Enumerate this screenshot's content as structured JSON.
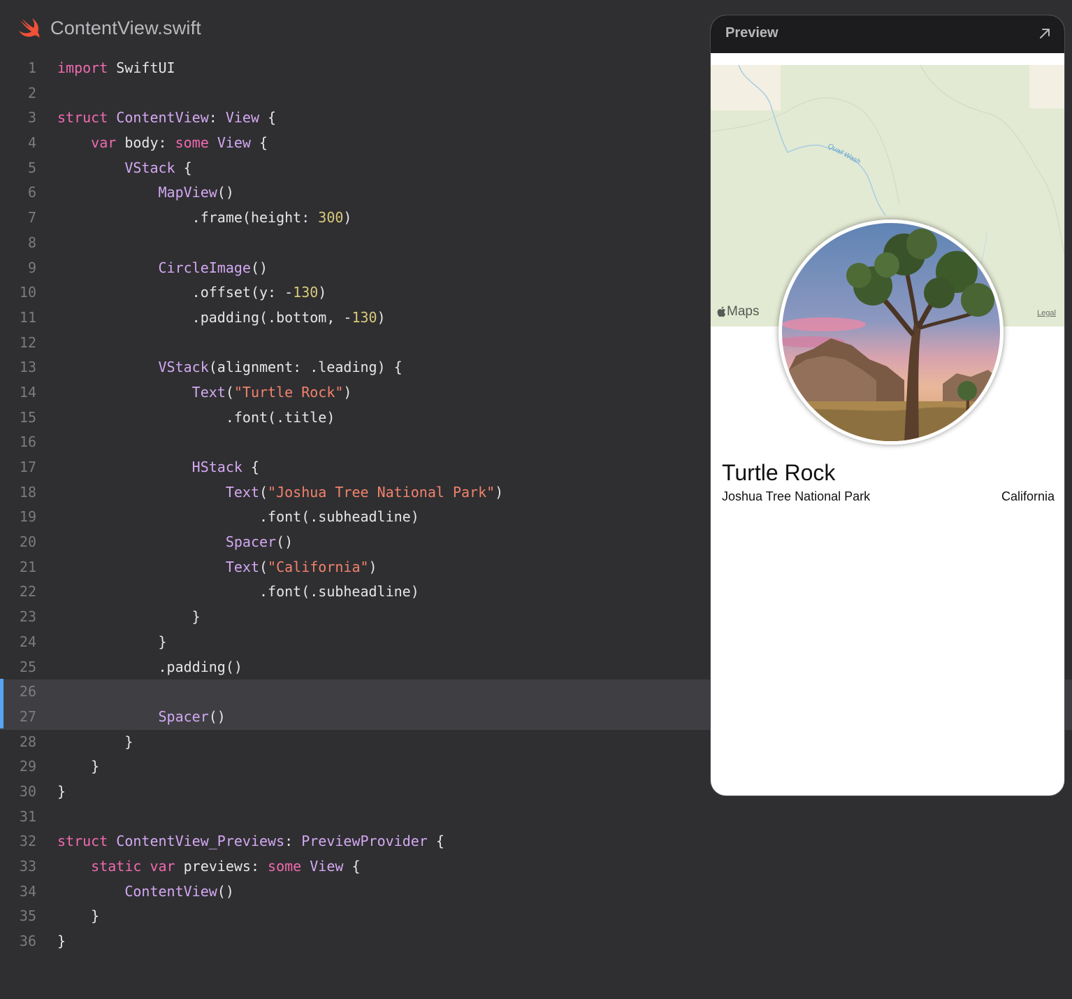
{
  "file": {
    "name": "ContentView.swift",
    "icon": "swift-icon",
    "icon_color": "#f05138"
  },
  "editor": {
    "active_lines": [
      26,
      27
    ],
    "lines": [
      {
        "n": "1",
        "tokens": [
          {
            "t": "import",
            "c": "kw"
          },
          {
            "t": " SwiftUI",
            "c": ""
          }
        ]
      },
      {
        "n": "2",
        "tokens": []
      },
      {
        "n": "3",
        "tokens": [
          {
            "t": "struct",
            "c": "kw"
          },
          {
            "t": " ",
            "c": ""
          },
          {
            "t": "ContentView",
            "c": "ty"
          },
          {
            "t": ": ",
            "c": ""
          },
          {
            "t": "View",
            "c": "ty"
          },
          {
            "t": " {",
            "c": ""
          }
        ]
      },
      {
        "n": "4",
        "tokens": [
          {
            "t": "    ",
            "c": ""
          },
          {
            "t": "var",
            "c": "kw"
          },
          {
            "t": " body: ",
            "c": ""
          },
          {
            "t": "some",
            "c": "kw"
          },
          {
            "t": " ",
            "c": ""
          },
          {
            "t": "View",
            "c": "ty"
          },
          {
            "t": " {",
            "c": ""
          }
        ]
      },
      {
        "n": "5",
        "tokens": [
          {
            "t": "        ",
            "c": ""
          },
          {
            "t": "VStack",
            "c": "ty"
          },
          {
            "t": " {",
            "c": ""
          }
        ]
      },
      {
        "n": "6",
        "tokens": [
          {
            "t": "            ",
            "c": ""
          },
          {
            "t": "MapView",
            "c": "ty"
          },
          {
            "t": "()",
            "c": ""
          }
        ]
      },
      {
        "n": "7",
        "tokens": [
          {
            "t": "                .frame(height: ",
            "c": ""
          },
          {
            "t": "300",
            "c": "nm"
          },
          {
            "t": ")",
            "c": ""
          }
        ]
      },
      {
        "n": "8",
        "tokens": []
      },
      {
        "n": "9",
        "tokens": [
          {
            "t": "            ",
            "c": ""
          },
          {
            "t": "CircleImage",
            "c": "ty"
          },
          {
            "t": "()",
            "c": ""
          }
        ]
      },
      {
        "n": "10",
        "tokens": [
          {
            "t": "                .offset(y: -",
            "c": ""
          },
          {
            "t": "130",
            "c": "nm"
          },
          {
            "t": ")",
            "c": ""
          }
        ]
      },
      {
        "n": "11",
        "tokens": [
          {
            "t": "                .padding(.bottom, -",
            "c": ""
          },
          {
            "t": "130",
            "c": "nm"
          },
          {
            "t": ")",
            "c": ""
          }
        ]
      },
      {
        "n": "12",
        "tokens": []
      },
      {
        "n": "13",
        "tokens": [
          {
            "t": "            ",
            "c": ""
          },
          {
            "t": "VStack",
            "c": "ty"
          },
          {
            "t": "(alignment: .leading) {",
            "c": ""
          }
        ]
      },
      {
        "n": "14",
        "tokens": [
          {
            "t": "                ",
            "c": ""
          },
          {
            "t": "Text",
            "c": "ty"
          },
          {
            "t": "(",
            "c": ""
          },
          {
            "t": "\"Turtle Rock\"",
            "c": "st"
          },
          {
            "t": ")",
            "c": ""
          }
        ]
      },
      {
        "n": "15",
        "tokens": [
          {
            "t": "                    .font(.title)",
            "c": ""
          }
        ]
      },
      {
        "n": "16",
        "tokens": []
      },
      {
        "n": "17",
        "tokens": [
          {
            "t": "                ",
            "c": ""
          },
          {
            "t": "HStack",
            "c": "ty"
          },
          {
            "t": " {",
            "c": ""
          }
        ]
      },
      {
        "n": "18",
        "tokens": [
          {
            "t": "                    ",
            "c": ""
          },
          {
            "t": "Text",
            "c": "ty"
          },
          {
            "t": "(",
            "c": ""
          },
          {
            "t": "\"Joshua Tree National Park\"",
            "c": "st"
          },
          {
            "t": ")",
            "c": ""
          }
        ]
      },
      {
        "n": "19",
        "tokens": [
          {
            "t": "                        .font(.subheadline)",
            "c": ""
          }
        ]
      },
      {
        "n": "20",
        "tokens": [
          {
            "t": "                    ",
            "c": ""
          },
          {
            "t": "Spacer",
            "c": "ty"
          },
          {
            "t": "()",
            "c": ""
          }
        ]
      },
      {
        "n": "21",
        "tokens": [
          {
            "t": "                    ",
            "c": ""
          },
          {
            "t": "Text",
            "c": "ty"
          },
          {
            "t": "(",
            "c": ""
          },
          {
            "t": "\"California\"",
            "c": "st"
          },
          {
            "t": ")",
            "c": ""
          }
        ]
      },
      {
        "n": "22",
        "tokens": [
          {
            "t": "                        .font(.subheadline)",
            "c": ""
          }
        ]
      },
      {
        "n": "23",
        "tokens": [
          {
            "t": "                }",
            "c": ""
          }
        ]
      },
      {
        "n": "24",
        "tokens": [
          {
            "t": "            }",
            "c": ""
          }
        ]
      },
      {
        "n": "25",
        "tokens": [
          {
            "t": "            .padding()",
            "c": ""
          }
        ]
      },
      {
        "n": "26",
        "tokens": []
      },
      {
        "n": "27",
        "tokens": [
          {
            "t": "            ",
            "c": ""
          },
          {
            "t": "Spacer",
            "c": "ty"
          },
          {
            "t": "()",
            "c": ""
          }
        ]
      },
      {
        "n": "28",
        "tokens": [
          {
            "t": "        }",
            "c": ""
          }
        ]
      },
      {
        "n": "29",
        "tokens": [
          {
            "t": "    }",
            "c": ""
          }
        ]
      },
      {
        "n": "30",
        "tokens": [
          {
            "t": "}",
            "c": ""
          }
        ]
      },
      {
        "n": "31",
        "tokens": []
      },
      {
        "n": "32",
        "tokens": [
          {
            "t": "struct",
            "c": "kw"
          },
          {
            "t": " ",
            "c": ""
          },
          {
            "t": "ContentView_Previews",
            "c": "ty"
          },
          {
            "t": ": ",
            "c": ""
          },
          {
            "t": "PreviewProvider",
            "c": "ty"
          },
          {
            "t": " {",
            "c": ""
          }
        ]
      },
      {
        "n": "33",
        "tokens": [
          {
            "t": "    ",
            "c": ""
          },
          {
            "t": "static",
            "c": "kw"
          },
          {
            "t": " ",
            "c": ""
          },
          {
            "t": "var",
            "c": "kw"
          },
          {
            "t": " previews: ",
            "c": ""
          },
          {
            "t": "some",
            "c": "kw"
          },
          {
            "t": " ",
            "c": ""
          },
          {
            "t": "View",
            "c": "ty"
          },
          {
            "t": " {",
            "c": ""
          }
        ]
      },
      {
        "n": "34",
        "tokens": [
          {
            "t": "        ",
            "c": ""
          },
          {
            "t": "ContentView",
            "c": "ty"
          },
          {
            "t": "()",
            "c": ""
          }
        ]
      },
      {
        "n": "35",
        "tokens": [
          {
            "t": "    }",
            "c": ""
          }
        ]
      },
      {
        "n": "36",
        "tokens": [
          {
            "t": "}",
            "c": ""
          }
        ]
      }
    ]
  },
  "preview": {
    "title": "Preview",
    "expand_icon": "arrow-up-right-icon",
    "map": {
      "label": "Quail Wash",
      "maps_logo": "Maps",
      "legal": "Legal"
    },
    "circle_image": "joshua-tree-photo",
    "landmark_title": "Turtle Rock",
    "park": "Joshua Tree National Park",
    "state": "California"
  },
  "colors": {
    "background": "#2f2f31",
    "keyword": "#f06ab0",
    "type": "#d4a8f3",
    "string": "#f2826d",
    "number": "#d9c97c",
    "active_line": "#3f3f43",
    "active_indicator": "#5aa4f4"
  }
}
